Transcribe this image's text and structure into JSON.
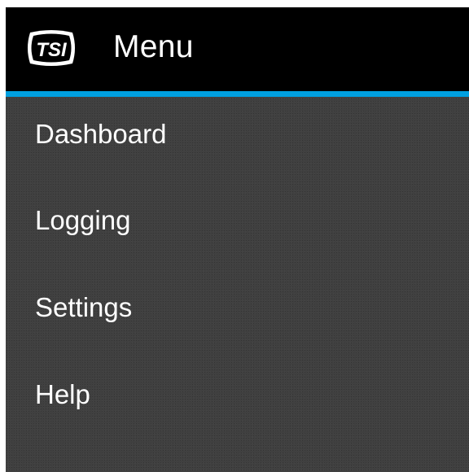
{
  "header": {
    "logo": "TSI",
    "title": "Menu"
  },
  "menu": {
    "items": [
      {
        "label": "Dashboard"
      },
      {
        "label": "Logging"
      },
      {
        "label": "Settings"
      },
      {
        "label": "Help"
      }
    ]
  },
  "colors": {
    "header_bg": "#000000",
    "accent": "#00a0e0",
    "panel_bg": "#404040",
    "text": "#ffffff"
  }
}
